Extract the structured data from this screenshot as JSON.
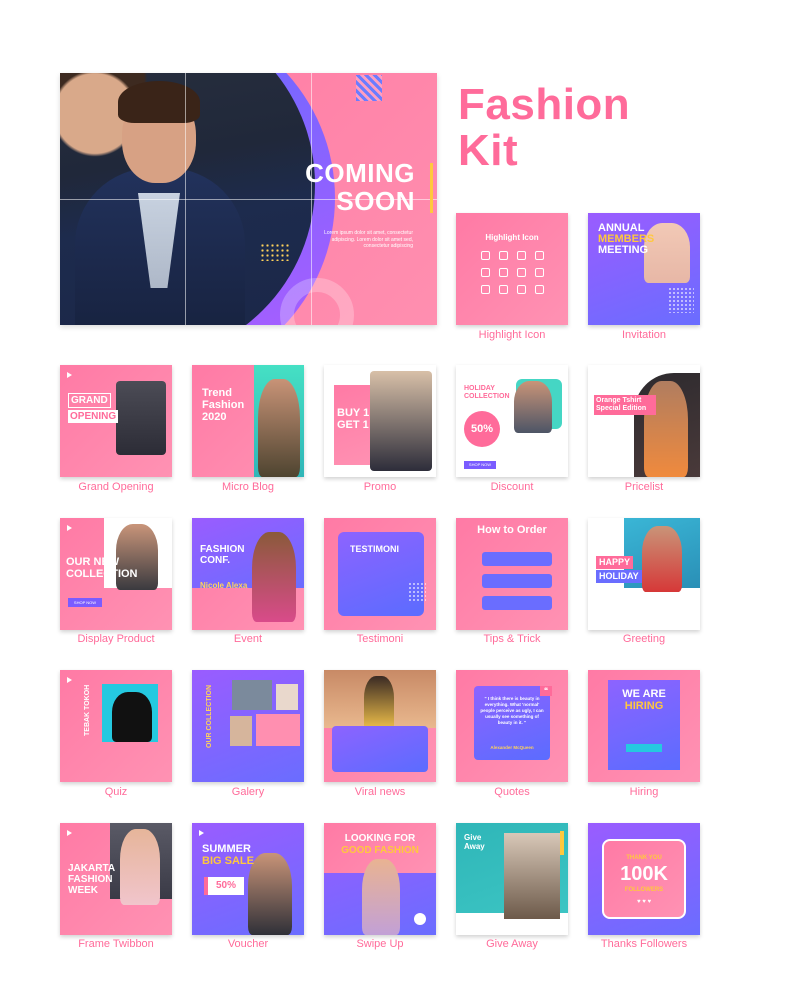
{
  "hero": {
    "headline_line1": "COMING",
    "headline_line2": "SOON",
    "blurb": "Lorem ipsum dolor sit amet, consectetur adipiscing. Lorem dolor sit amet sed, consectetur adipiscing"
  },
  "kit": {
    "title_line1": "Fashion",
    "title_line2": "Kit"
  },
  "colors": {
    "accent_pink": "#ff6b9a",
    "card_pink": "#ff7aa5",
    "accent_purple": "#7a5cff",
    "accent_yellow": "#ffc83d",
    "accent_teal": "#2fb6b8"
  },
  "cards": {
    "highlight_icon": {
      "caption": "Highlight Icon",
      "heading": "Highlight Icon"
    },
    "invitation": {
      "caption": "Invitation",
      "heading_1": "ANNUAL",
      "heading_2": "MEMBERS",
      "heading_3": "MEETING"
    },
    "grand_opening": {
      "caption": "Grand Opening",
      "heading_1": "GRAND",
      "heading_2": "OPENING"
    },
    "micro_blog": {
      "caption": "Micro Blog",
      "heading": "Trend Fashion 2020"
    },
    "promo": {
      "caption": "Promo",
      "heading": "BUY 1 GET 1"
    },
    "discount": {
      "caption": "Discount",
      "heading": "HOLIDAY COLLECTION",
      "badge": "50%",
      "button": "SHOP NOW"
    },
    "pricelist": {
      "caption": "Pricelist",
      "heading": "Orange Tshirt Special Edition"
    },
    "display_product": {
      "caption": "Display Product",
      "heading": "OUR NEW COLLECTION",
      "button": "SHOP NOW"
    },
    "event": {
      "caption": "Event",
      "heading": "FASHION CONF.",
      "name": "Nicole Alexa"
    },
    "testimoni": {
      "caption": "Testimoni",
      "heading": "TESTIMONI"
    },
    "tips_trick": {
      "caption": "Tips & Trick",
      "heading": "How to Order"
    },
    "greeting": {
      "caption": "Greeting",
      "heading_1": "HAPPY",
      "heading_2": "HOLIDAY"
    },
    "quiz": {
      "caption": "Quiz",
      "heading": "TEBAK TOKOH"
    },
    "galery": {
      "caption": "Galery",
      "heading": "OUR COLLECTION"
    },
    "viral_news": {
      "caption": "Viral news"
    },
    "quotes": {
      "caption": "Quotes",
      "quote": "\" I think there is beauty in everything. What 'normal' people perceive as ugly, I can usually see something of beauty in it. \"",
      "author": "Alexander McQueen"
    },
    "hiring": {
      "caption": "Hiring",
      "heading_1": "WE ARE",
      "heading_2": "HIRING"
    },
    "frame_twibbon": {
      "caption": "Frame Twibbon",
      "heading": "JAKARTA FASHION WEEK"
    },
    "voucher": {
      "caption": "Voucher",
      "heading_1": "SUMMER",
      "heading_2": "BIG SALE",
      "badge": "50%"
    },
    "swipe_up": {
      "caption": "Swipe Up",
      "heading_1": "LOOKING FOR",
      "heading_2": "GOOD FASHION"
    },
    "give_away": {
      "caption": "Give Away",
      "heading": "Give Away"
    },
    "thanks_followers": {
      "caption": "Thanks Followers",
      "line_1": "THANK YOU",
      "line_2": "100K",
      "line_3": "FOLLOWERS"
    }
  }
}
